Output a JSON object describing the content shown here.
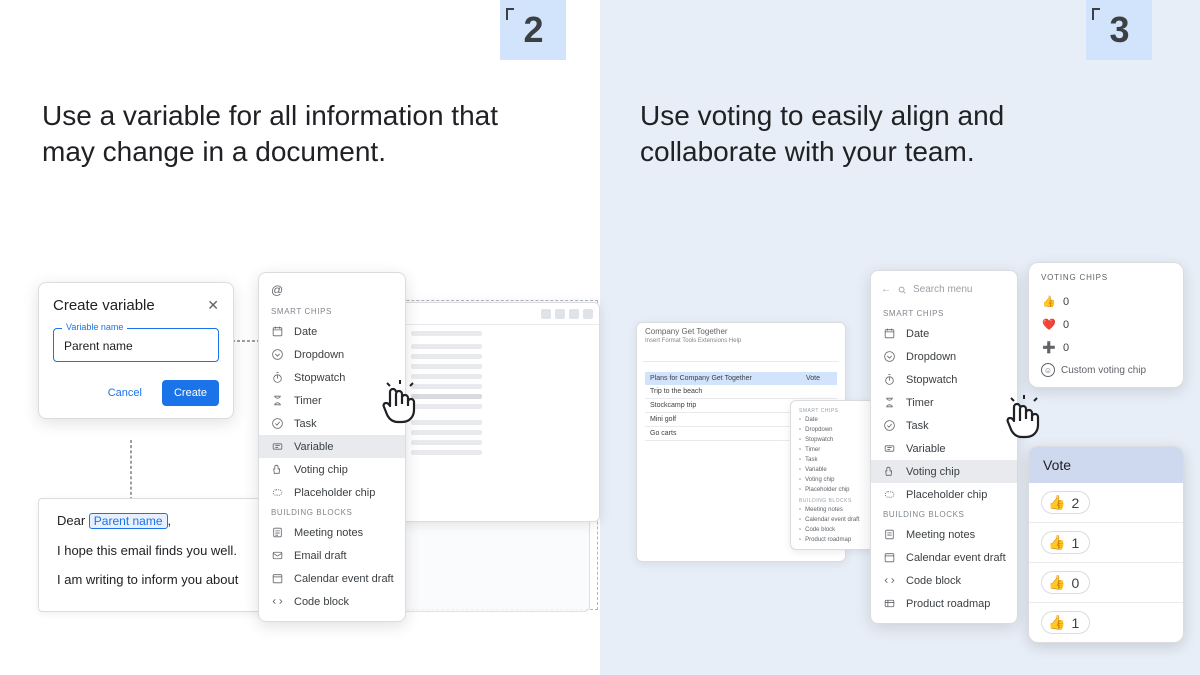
{
  "steps": {
    "left": "2",
    "right": "3"
  },
  "headline_left": "Use a variable for all information that may change in a document.",
  "headline_right": "Use voting to easily align and collaborate with your team.",
  "dialog": {
    "title": "Create variable",
    "field_label": "Variable name",
    "field_value": "Parent name",
    "cancel": "Cancel",
    "create": "Create"
  },
  "email": {
    "greeting_prefix": "Dear ",
    "variable_chip": "Parent name",
    "greeting_suffix": ",",
    "line2": "I hope this email finds you well.",
    "line3": "I am writing to inform you about"
  },
  "menu": {
    "at_hint": "@",
    "section_smart": "SMART CHIPS",
    "section_blocks": "BUILDING BLOCKS",
    "items_smart": [
      "Date",
      "Dropdown",
      "Stopwatch",
      "Timer",
      "Task",
      "Variable",
      "Voting chip",
      "Placeholder chip"
    ],
    "items_blocks_left": [
      "Meeting notes",
      "Email draft",
      "Calendar event draft",
      "Code block"
    ],
    "items_blocks_right": [
      "Meeting notes",
      "Calendar event draft",
      "Code block",
      "Product roadmap"
    ],
    "search_placeholder": "Search menu"
  },
  "votepage": {
    "doc_title": "Company Get Together",
    "toolbar_hint": "Insert  Format  Tools  Extensions  Help",
    "header1": "Plans for Company Get Together",
    "header2": "Vote",
    "rows": [
      "Trip to the beach",
      "Stockcamp trip",
      "Mini golf",
      "Go carts"
    ]
  },
  "voting_chips": {
    "title": "VOTING CHIPS",
    "rows": [
      {
        "emoji": "👍",
        "count": "0"
      },
      {
        "emoji": "❤️",
        "count": "0"
      },
      {
        "emoji": "➕",
        "count": "0"
      }
    ],
    "custom": "Custom voting chip"
  },
  "vote_result": {
    "title": "Vote",
    "rows": [
      {
        "emoji": "👍",
        "count": "2"
      },
      {
        "emoji": "👍",
        "count": "1"
      },
      {
        "emoji": "👍",
        "count": "0"
      },
      {
        "emoji": "👍",
        "count": "1"
      }
    ]
  },
  "mini_menu": {
    "section_smart": "SMART CHIPS",
    "items_smart": [
      "Date",
      "Dropdown",
      "Stopwatch",
      "Timer",
      "Task",
      "Variable",
      "Voting chip",
      "Placeholder chip"
    ],
    "section_blocks": "BUILDING BLOCKS",
    "items_blocks": [
      "Meeting notes",
      "Calendar event draft",
      "Code block",
      "Product roadmap"
    ]
  }
}
